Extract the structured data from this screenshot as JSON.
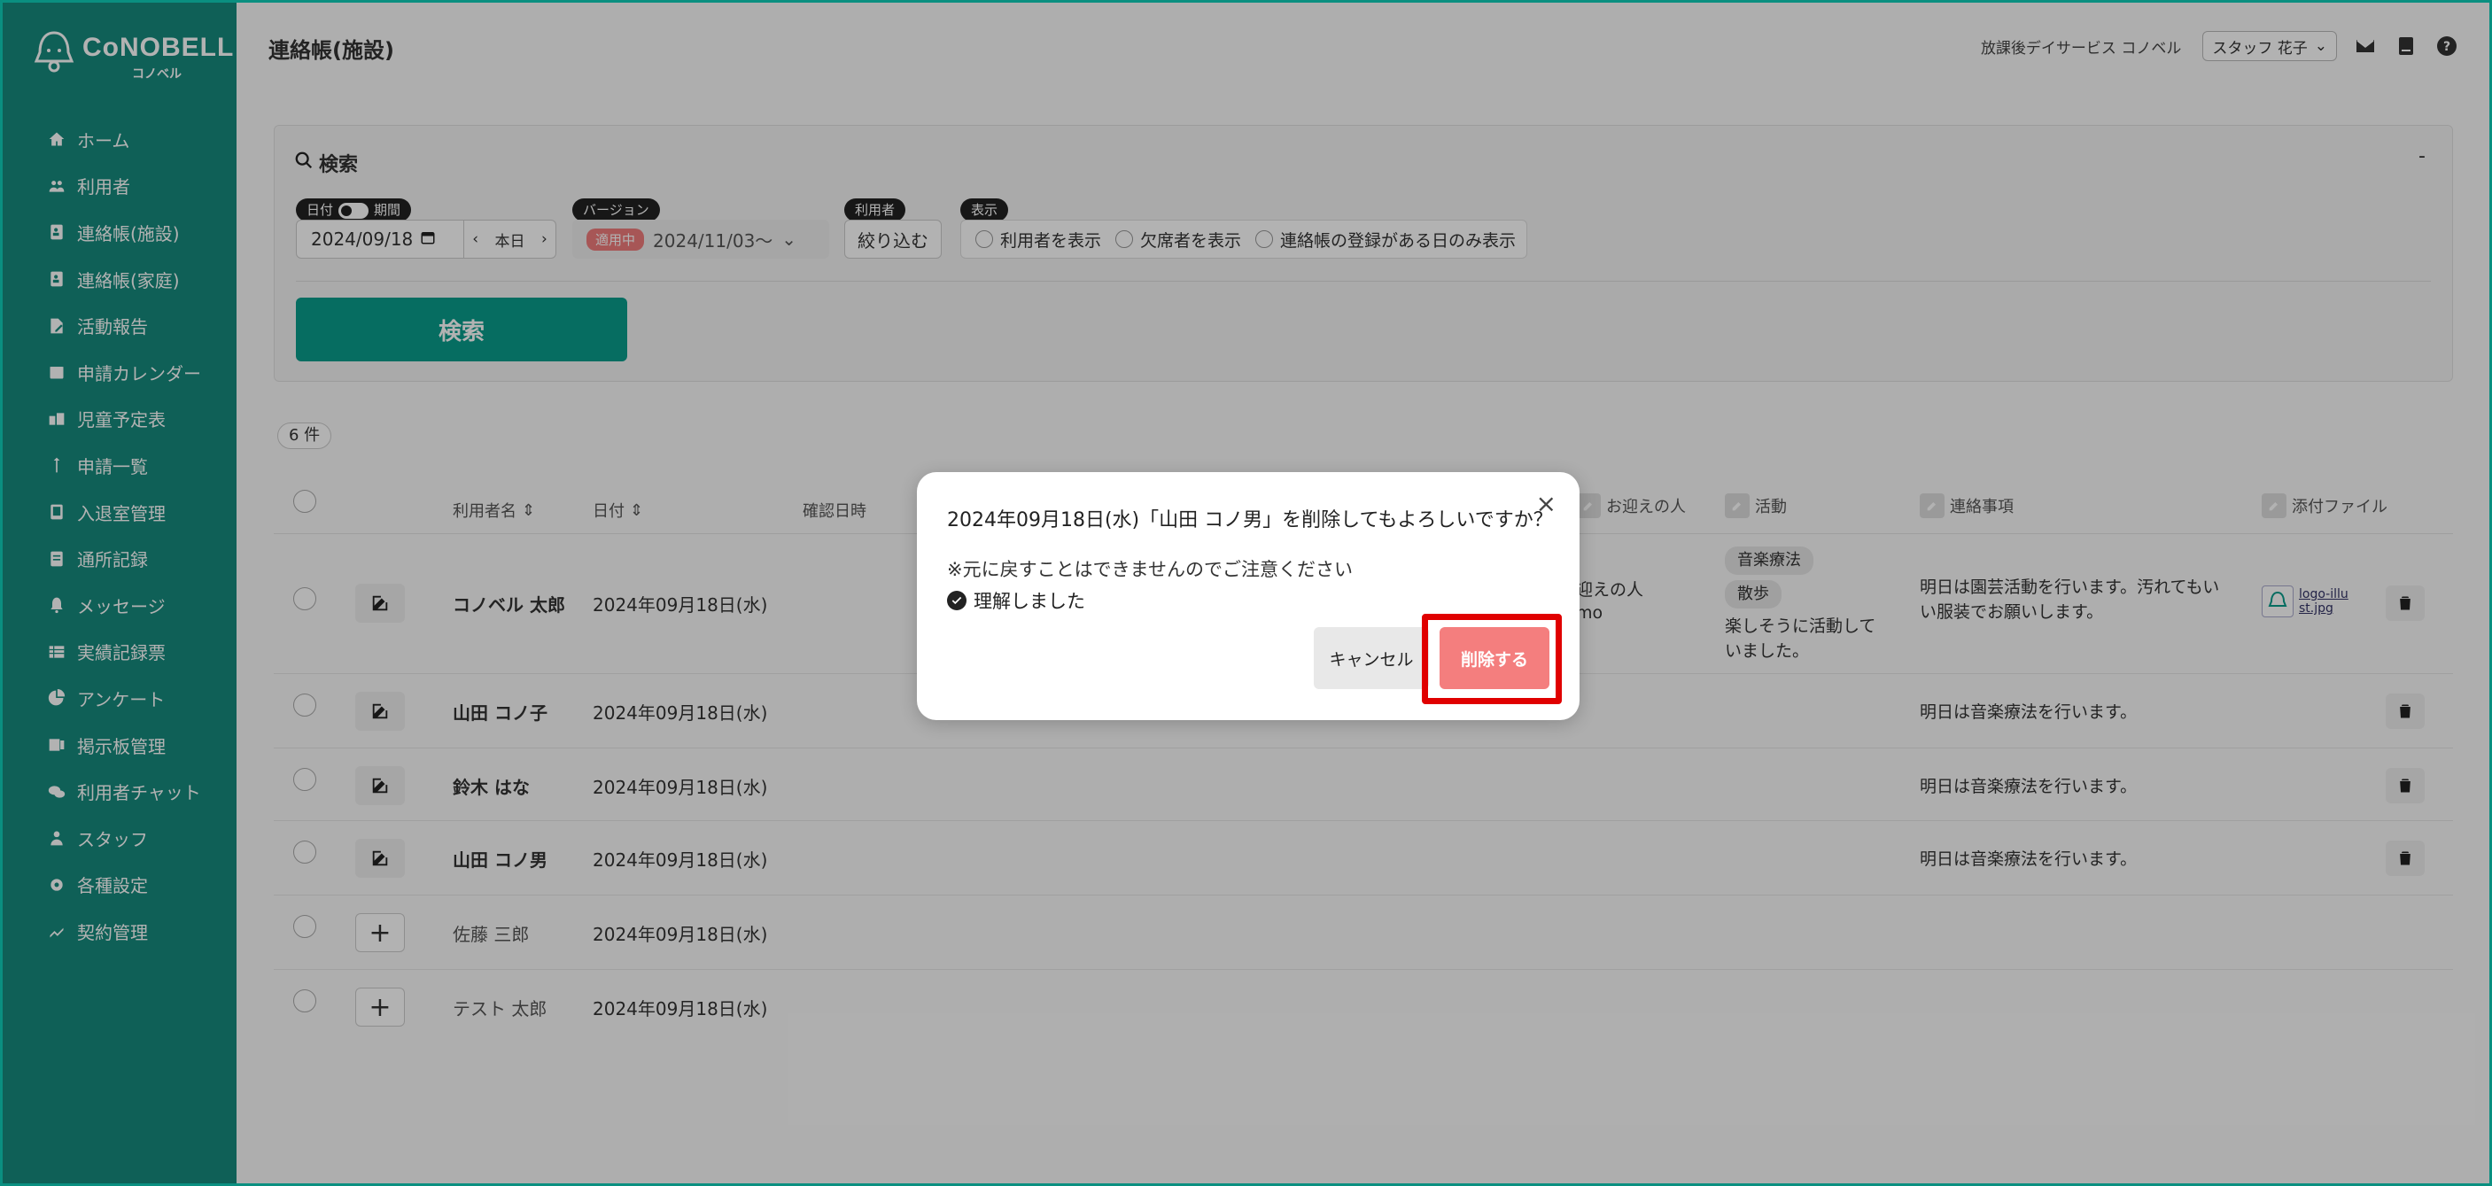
{
  "app": {
    "logo_text": "CoNOBELL",
    "logo_sub": "コノベル"
  },
  "sidebar": {
    "items": [
      {
        "label": "ホーム",
        "icon": "home-icon"
      },
      {
        "label": "利用者",
        "icon": "users-icon"
      },
      {
        "label": "連絡帳(施設)",
        "icon": "notebook-icon"
      },
      {
        "label": "連絡帳(家庭)",
        "icon": "notebook-icon"
      },
      {
        "label": "活動報告",
        "icon": "report-icon"
      },
      {
        "label": "申請カレンダー",
        "icon": "calendar-icon"
      },
      {
        "label": "児童予定表",
        "icon": "schedule-icon"
      },
      {
        "label": "申請一覧",
        "icon": "list-icon"
      },
      {
        "label": "入退室管理",
        "icon": "tablet-icon"
      },
      {
        "label": "通所記録",
        "icon": "record-icon"
      },
      {
        "label": "メッセージ",
        "icon": "bell-icon"
      },
      {
        "label": "実績記録票",
        "icon": "table-icon"
      },
      {
        "label": "アンケート",
        "icon": "pie-icon"
      },
      {
        "label": "掲示板管理",
        "icon": "board-icon"
      },
      {
        "label": "利用者チャット",
        "icon": "chat-icon"
      },
      {
        "label": "スタッフ",
        "icon": "staff-icon"
      },
      {
        "label": "各種設定",
        "icon": "gear-icon"
      },
      {
        "label": "契約管理",
        "icon": "contract-icon"
      }
    ]
  },
  "header": {
    "title": "連絡帳(施設)",
    "facility": "放課後デイサービス コノベル",
    "user": "スタッフ 花子"
  },
  "search": {
    "title": "検索",
    "collapse": "-",
    "label_date": "日付",
    "label_period": "期間",
    "date_value": "2024/09/18",
    "today": "本日",
    "label_version": "バージョン",
    "version_badge": "適用中",
    "version_value": "2024/11/03〜",
    "label_user": "利用者",
    "narrow_button": "絞り込む",
    "label_display": "表示",
    "display_options": [
      "利用者を表示",
      "欠席者を表示",
      "連絡帳の登録がある日のみ表示"
    ],
    "search_button": "検索"
  },
  "results": {
    "count": "6 件",
    "columns": {
      "name": "利用者名",
      "date": "日付",
      "confirmed": "確認日時",
      "pickup": "お迎えの人",
      "activity": "活動",
      "notes": "連絡事項",
      "attachment": "添付ファイル"
    },
    "rows": [
      {
        "name": "コノベル 太郎",
        "date": "2024年09月18日(水)",
        "pickup": "迎えの人",
        "pickup2": "mo",
        "tags": [
          "音楽療法",
          "散歩"
        ],
        "activity": "楽しそうに活動していました。",
        "notes": "明日は園芸活動を行います。汚れてもいい服装でお願いします。",
        "attachment": "logo-illust.jpg"
      },
      {
        "name": "山田 コノ子",
        "date": "2024年09月18日(水)",
        "notes": "明日は音楽療法を行います。"
      },
      {
        "name": "鈴木 はな",
        "date": "2024年09月18日(水)",
        "notes": "明日は音楽療法を行います。"
      },
      {
        "name": "山田 コノ男",
        "date": "2024年09月18日(水)",
        "notes": "明日は音楽療法を行います。"
      },
      {
        "name": "佐藤 三郎",
        "date": "2024年09月18日(水)"
      },
      {
        "name": "テスト 太郎",
        "date": "2024年09月18日(水)"
      }
    ]
  },
  "modal": {
    "title": "2024年09月18日(水)「山田 コノ男」を削除してもよろしいですか？",
    "warning": "※元に戻すことはできませんのでご注意ください",
    "confirm": "理解しました",
    "cancel": "キャンセル",
    "delete": "削除する"
  }
}
